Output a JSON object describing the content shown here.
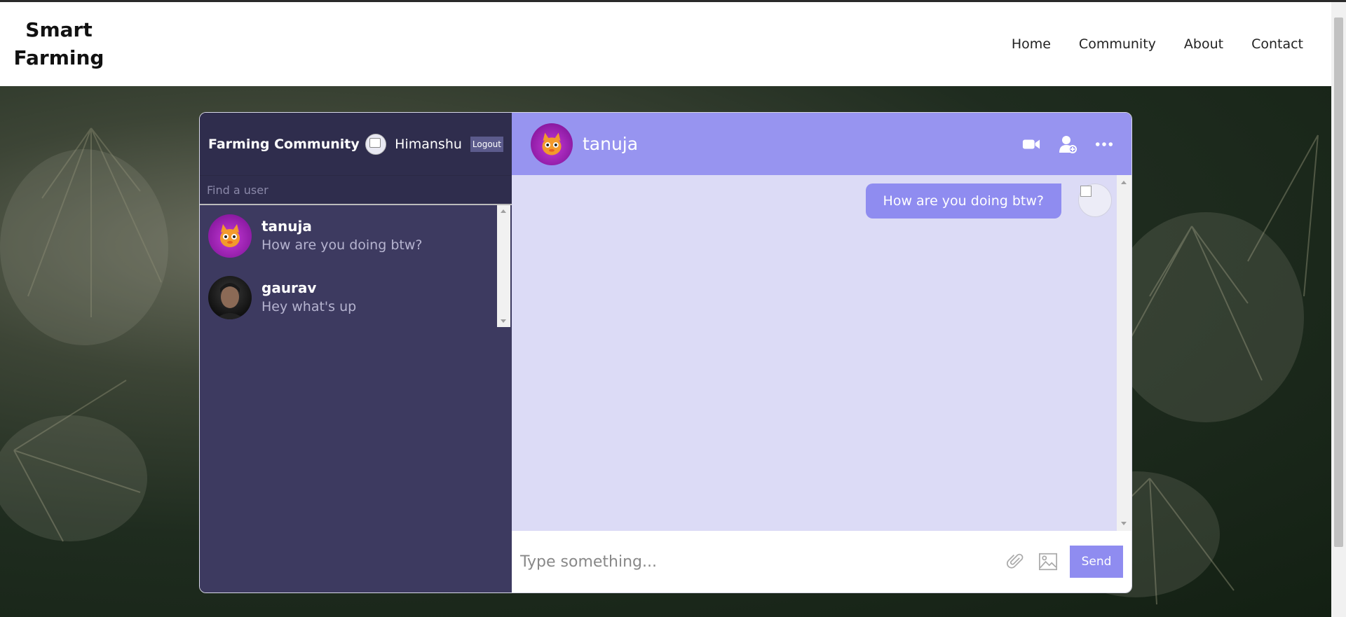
{
  "navbar": {
    "brand_line1": "Smart",
    "brand_line2": "Farming",
    "links": [
      "Home",
      "Community",
      "About",
      "Contact"
    ]
  },
  "sidebar": {
    "title": "Farming Community",
    "current_user": "Himanshu",
    "logout_label": "Logout",
    "search_placeholder": "Find a user",
    "chats": [
      {
        "name": "tanuja",
        "last_message": "How are you doing btw?"
      },
      {
        "name": "gaurav",
        "last_message": "Hey what's up"
      }
    ]
  },
  "conversation": {
    "contact_name": "tanuja",
    "header_icons": [
      "video-camera-icon",
      "add-user-icon",
      "more-options-icon"
    ],
    "messages": [
      {
        "text": "How are you doing btw?",
        "from": "me"
      }
    ]
  },
  "composer": {
    "placeholder": "Type something...",
    "icons": [
      "paperclip-icon",
      "image-icon"
    ],
    "send_label": "Send"
  },
  "colors": {
    "sidebar_bg": "#3d3a60",
    "sidebar_header_bg": "#2f2d4d",
    "accent": "#9794f0",
    "messages_bg": "#dcdbf6",
    "bubble": "#8f8cf0"
  }
}
